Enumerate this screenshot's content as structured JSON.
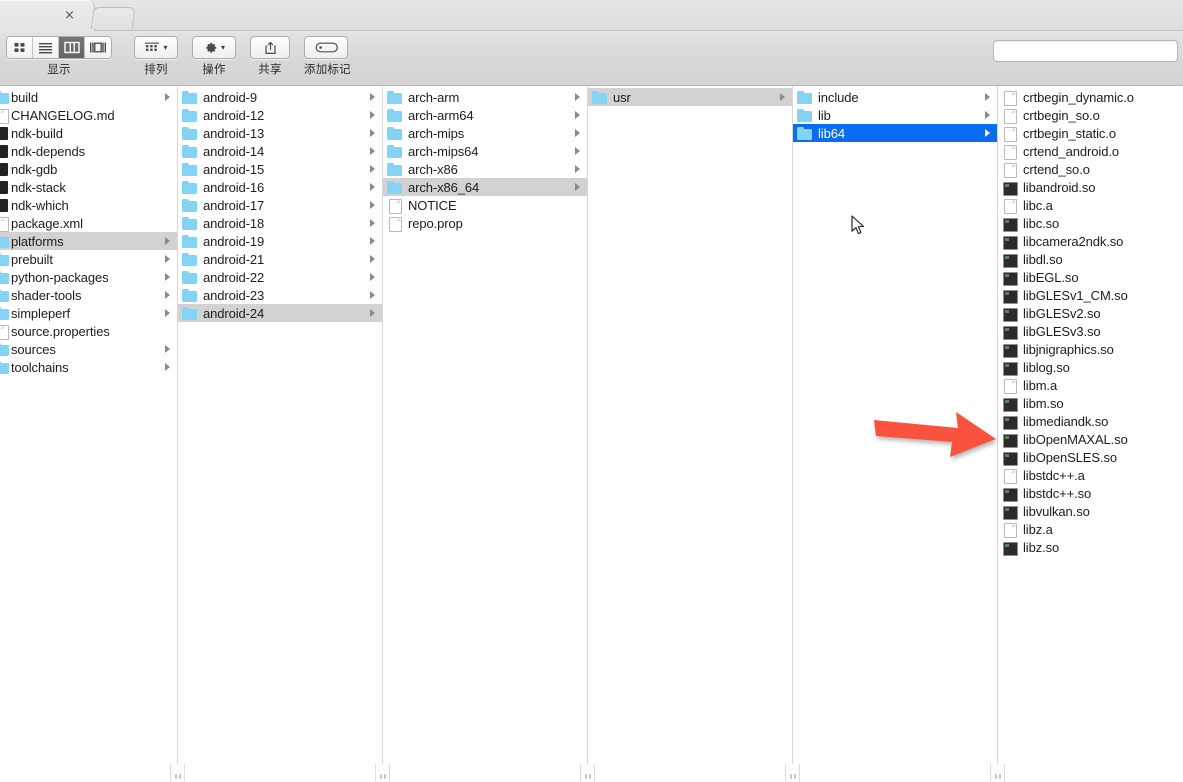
{
  "window": {
    "tab_close_label": "×"
  },
  "toolbar": {
    "view_group_label": "显示",
    "arrange_label": "排列",
    "action_label": "操作",
    "share_label": "共享",
    "tag_label": "添加标记",
    "view_buttons": [
      {
        "name": "icon-view",
        "icon": "grid-icon"
      },
      {
        "name": "list-view",
        "icon": "list-icon"
      },
      {
        "name": "column-view",
        "icon": "columns-icon",
        "active": true
      },
      {
        "name": "gallery-view",
        "icon": "gallery-icon"
      }
    ],
    "chevron": "⌄",
    "search": {
      "value": "",
      "placeholder": ""
    }
  },
  "columns": [
    {
      "name": "column-ndk-root",
      "items": [
        {
          "label": "build",
          "icon": "folder-icon",
          "kind": "folder",
          "arrow": true,
          "selected": "none"
        },
        {
          "label": "CHANGELOG.md",
          "icon": "document-icon",
          "kind": "doc",
          "arrow": false,
          "selected": "none"
        },
        {
          "label": "ndk-build",
          "icon": "unix-executable-icon",
          "kind": "unix",
          "arrow": false,
          "selected": "none"
        },
        {
          "label": "ndk-depends",
          "icon": "unix-executable-icon",
          "kind": "unix",
          "arrow": false,
          "selected": "none"
        },
        {
          "label": "ndk-gdb",
          "icon": "unix-executable-icon",
          "kind": "unix",
          "arrow": false,
          "selected": "none"
        },
        {
          "label": "ndk-stack",
          "icon": "unix-executable-icon",
          "kind": "unix",
          "arrow": false,
          "selected": "none"
        },
        {
          "label": "ndk-which",
          "icon": "unix-executable-icon",
          "kind": "unix",
          "arrow": false,
          "selected": "none"
        },
        {
          "label": "package.xml",
          "icon": "document-icon",
          "kind": "doc",
          "arrow": false,
          "selected": "none"
        },
        {
          "label": "platforms",
          "icon": "folder-icon",
          "kind": "folder",
          "arrow": true,
          "selected": "gray"
        },
        {
          "label": "prebuilt",
          "icon": "folder-icon",
          "kind": "folder",
          "arrow": true,
          "selected": "none"
        },
        {
          "label": "python-packages",
          "icon": "folder-icon",
          "kind": "folder",
          "arrow": true,
          "selected": "none"
        },
        {
          "label": "shader-tools",
          "icon": "folder-icon",
          "kind": "folder",
          "arrow": true,
          "selected": "none"
        },
        {
          "label": "simpleperf",
          "icon": "folder-icon",
          "kind": "folder",
          "arrow": true,
          "selected": "none"
        },
        {
          "label": "source.properties",
          "icon": "document-icon",
          "kind": "doc",
          "arrow": false,
          "selected": "none"
        },
        {
          "label": "sources",
          "icon": "folder-icon",
          "kind": "folder",
          "arrow": true,
          "selected": "none"
        },
        {
          "label": "toolchains",
          "icon": "folder-icon",
          "kind": "folder",
          "arrow": true,
          "selected": "none"
        }
      ]
    },
    {
      "name": "column-platforms",
      "items": [
        {
          "label": "android-9",
          "icon": "folder-icon",
          "kind": "folder",
          "arrow": true,
          "selected": "none"
        },
        {
          "label": "android-12",
          "icon": "folder-icon",
          "kind": "folder",
          "arrow": true,
          "selected": "none"
        },
        {
          "label": "android-13",
          "icon": "folder-icon",
          "kind": "folder",
          "arrow": true,
          "selected": "none"
        },
        {
          "label": "android-14",
          "icon": "folder-icon",
          "kind": "folder",
          "arrow": true,
          "selected": "none"
        },
        {
          "label": "android-15",
          "icon": "folder-icon",
          "kind": "folder",
          "arrow": true,
          "selected": "none"
        },
        {
          "label": "android-16",
          "icon": "folder-icon",
          "kind": "folder",
          "arrow": true,
          "selected": "none"
        },
        {
          "label": "android-17",
          "icon": "folder-icon",
          "kind": "folder",
          "arrow": true,
          "selected": "none"
        },
        {
          "label": "android-18",
          "icon": "folder-icon",
          "kind": "folder",
          "arrow": true,
          "selected": "none"
        },
        {
          "label": "android-19",
          "icon": "folder-icon",
          "kind": "folder",
          "arrow": true,
          "selected": "none"
        },
        {
          "label": "android-21",
          "icon": "folder-icon",
          "kind": "folder",
          "arrow": true,
          "selected": "none"
        },
        {
          "label": "android-22",
          "icon": "folder-icon",
          "kind": "folder",
          "arrow": true,
          "selected": "none"
        },
        {
          "label": "android-23",
          "icon": "folder-icon",
          "kind": "folder",
          "arrow": true,
          "selected": "none"
        },
        {
          "label": "android-24",
          "icon": "folder-icon",
          "kind": "folder",
          "arrow": true,
          "selected": "gray"
        }
      ]
    },
    {
      "name": "column-android-24",
      "items": [
        {
          "label": "arch-arm",
          "icon": "folder-icon",
          "kind": "folder",
          "arrow": true,
          "selected": "none"
        },
        {
          "label": "arch-arm64",
          "icon": "folder-icon",
          "kind": "folder",
          "arrow": true,
          "selected": "none"
        },
        {
          "label": "arch-mips",
          "icon": "folder-icon",
          "kind": "folder",
          "arrow": true,
          "selected": "none"
        },
        {
          "label": "arch-mips64",
          "icon": "folder-icon",
          "kind": "folder",
          "arrow": true,
          "selected": "none"
        },
        {
          "label": "arch-x86",
          "icon": "folder-icon",
          "kind": "folder",
          "arrow": true,
          "selected": "none"
        },
        {
          "label": "arch-x86_64",
          "icon": "folder-icon",
          "kind": "folder",
          "arrow": true,
          "selected": "gray"
        },
        {
          "label": "NOTICE",
          "icon": "document-icon",
          "kind": "doc",
          "arrow": false,
          "selected": "none"
        },
        {
          "label": "repo.prop",
          "icon": "document-icon",
          "kind": "doc",
          "arrow": false,
          "selected": "none"
        }
      ]
    },
    {
      "name": "column-arch-x86-64",
      "items": [
        {
          "label": "usr",
          "icon": "folder-icon",
          "kind": "folder",
          "arrow": true,
          "selected": "gray"
        }
      ]
    },
    {
      "name": "column-usr",
      "items": [
        {
          "label": "include",
          "icon": "folder-icon",
          "kind": "folder",
          "arrow": true,
          "selected": "none"
        },
        {
          "label": "lib",
          "icon": "folder-icon",
          "kind": "folder",
          "arrow": true,
          "selected": "none"
        },
        {
          "label": "lib64",
          "icon": "folder-icon",
          "kind": "folder",
          "arrow": true,
          "selected": "blue"
        }
      ]
    },
    {
      "name": "column-lib64",
      "items": [
        {
          "label": "crtbegin_dynamic.o",
          "icon": "document-icon",
          "kind": "doc",
          "arrow": false,
          "selected": "none"
        },
        {
          "label": "crtbegin_so.o",
          "icon": "document-icon",
          "kind": "doc",
          "arrow": false,
          "selected": "none"
        },
        {
          "label": "crtbegin_static.o",
          "icon": "document-icon",
          "kind": "doc",
          "arrow": false,
          "selected": "none"
        },
        {
          "label": "crtend_android.o",
          "icon": "document-icon",
          "kind": "doc",
          "arrow": false,
          "selected": "none"
        },
        {
          "label": "crtend_so.o",
          "icon": "document-icon",
          "kind": "doc",
          "arrow": false,
          "selected": "none"
        },
        {
          "label": "libandroid.so",
          "icon": "binary-icon",
          "kind": "exec",
          "arrow": false,
          "selected": "none"
        },
        {
          "label": "libc.a",
          "icon": "document-icon",
          "kind": "doc",
          "arrow": false,
          "selected": "none"
        },
        {
          "label": "libc.so",
          "icon": "binary-icon",
          "kind": "exec",
          "arrow": false,
          "selected": "none"
        },
        {
          "label": "libcamera2ndk.so",
          "icon": "binary-icon",
          "kind": "exec",
          "arrow": false,
          "selected": "none"
        },
        {
          "label": "libdl.so",
          "icon": "binary-icon",
          "kind": "exec",
          "arrow": false,
          "selected": "none"
        },
        {
          "label": "libEGL.so",
          "icon": "binary-icon",
          "kind": "exec",
          "arrow": false,
          "selected": "none"
        },
        {
          "label": "libGLESv1_CM.so",
          "icon": "binary-icon",
          "kind": "exec",
          "arrow": false,
          "selected": "none"
        },
        {
          "label": "libGLESv2.so",
          "icon": "binary-icon",
          "kind": "exec",
          "arrow": false,
          "selected": "none"
        },
        {
          "label": "libGLESv3.so",
          "icon": "binary-icon",
          "kind": "exec",
          "arrow": false,
          "selected": "none"
        },
        {
          "label": "libjnigraphics.so",
          "icon": "binary-icon",
          "kind": "exec",
          "arrow": false,
          "selected": "none"
        },
        {
          "label": "liblog.so",
          "icon": "binary-icon",
          "kind": "exec",
          "arrow": false,
          "selected": "none"
        },
        {
          "label": "libm.a",
          "icon": "document-icon",
          "kind": "doc",
          "arrow": false,
          "selected": "none"
        },
        {
          "label": "libm.so",
          "icon": "binary-icon",
          "kind": "exec",
          "arrow": false,
          "selected": "none"
        },
        {
          "label": "libmediandk.so",
          "icon": "binary-icon",
          "kind": "exec",
          "arrow": false,
          "selected": "none"
        },
        {
          "label": "libOpenMAXAL.so",
          "icon": "binary-icon",
          "kind": "exec",
          "arrow": false,
          "selected": "none"
        },
        {
          "label": "libOpenSLES.so",
          "icon": "binary-icon",
          "kind": "exec",
          "arrow": false,
          "selected": "none"
        },
        {
          "label": "libstdc++.a",
          "icon": "document-icon",
          "kind": "doc",
          "arrow": false,
          "selected": "none"
        },
        {
          "label": "libstdc++.so",
          "icon": "binary-icon",
          "kind": "exec",
          "arrow": false,
          "selected": "none"
        },
        {
          "label": "libvulkan.so",
          "icon": "binary-icon",
          "kind": "exec",
          "arrow": false,
          "selected": "none"
        },
        {
          "label": "libz.a",
          "icon": "document-icon",
          "kind": "doc",
          "arrow": false,
          "selected": "none"
        },
        {
          "label": "libz.so",
          "icon": "binary-icon",
          "kind": "exec",
          "arrow": false,
          "selected": "none"
        }
      ]
    }
  ],
  "annotation": {
    "arrow_color": "#F9523F",
    "arrow_target_label": "liblog.so"
  },
  "colors": {
    "selection_blue": "#0a6cf1",
    "selection_gray": "#d2d2d2",
    "folder_blue": "#82d3f4",
    "toolbar_gray": "#d8d8d8"
  }
}
